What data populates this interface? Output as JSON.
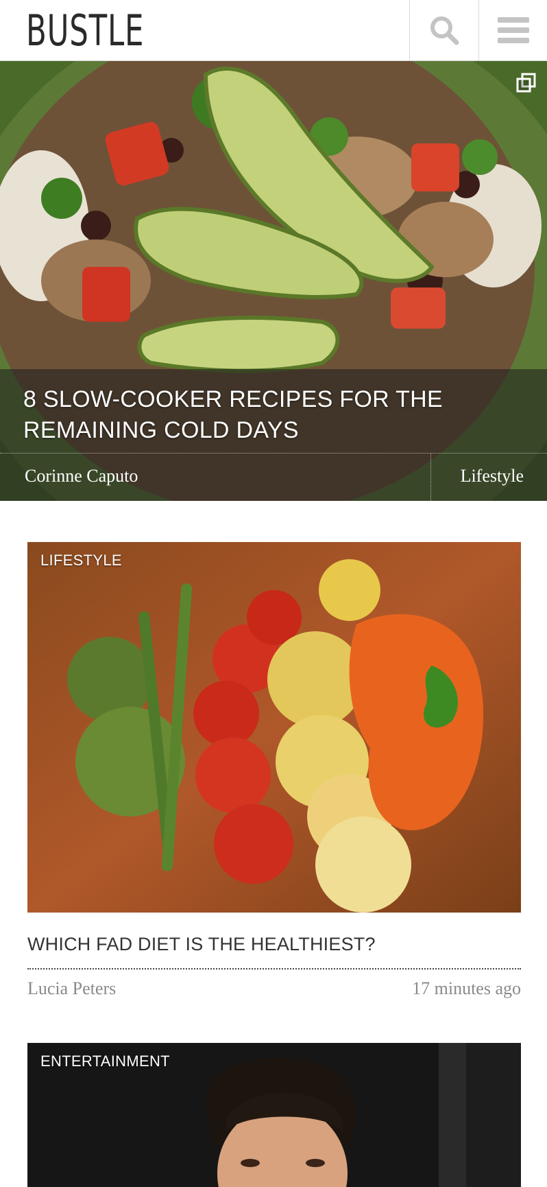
{
  "header": {
    "logo": "BUSTLE",
    "search_icon": "search-icon",
    "menu_icon": "hamburger-menu-icon"
  },
  "hero": {
    "title": "8 SLOW-COOKER RECIPES FOR THE REMAINING COLD DAYS",
    "author": "Corinne Caputo",
    "category": "Lifestyle",
    "gallery_icon": "gallery-icon"
  },
  "articles": [
    {
      "tag": "LIFESTYLE",
      "title": "WHICH FAD DIET IS THE HEALTHIEST?",
      "author": "Lucia Peters",
      "time": "17 minutes ago"
    },
    {
      "tag": "ENTERTAINMENT"
    }
  ],
  "colors": {
    "text_dark": "#333333",
    "meta_gray": "#8a8a8a",
    "border": "#d9d9d9"
  }
}
